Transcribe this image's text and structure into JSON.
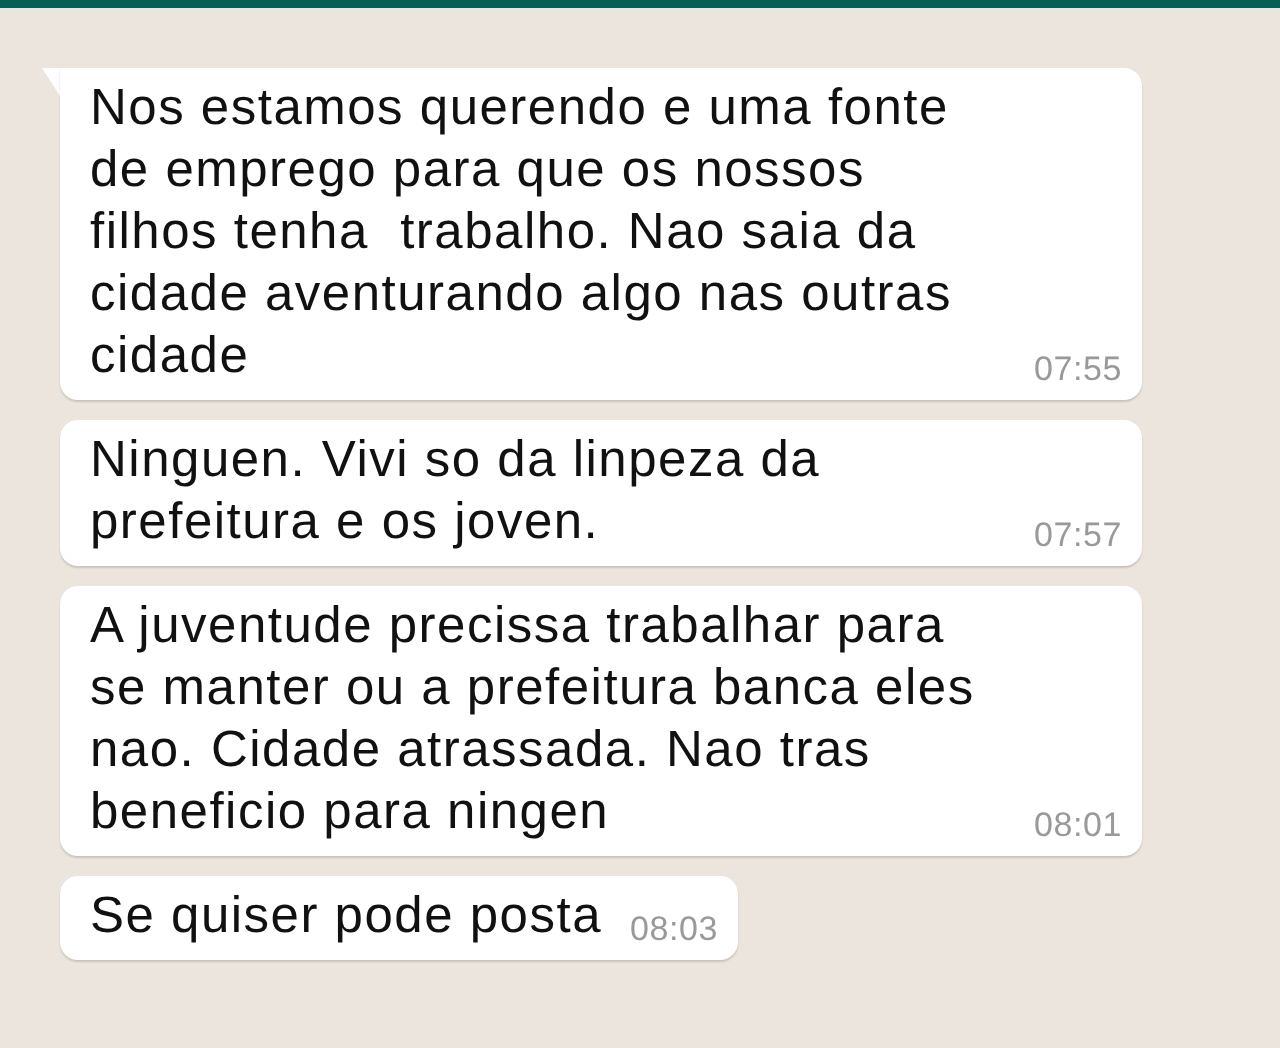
{
  "messages": [
    {
      "text": "Nos estamos querendo e uma fonte de emprego para que os nossos filhos tenha  trabalho. Nao saia da cidade aventurando algo nas outras cidade",
      "time": "07:55",
      "tail": true
    },
    {
      "text": "Ninguen. Vivi so da linpeza da prefeitura e os joven.",
      "time": "07:57",
      "tail": false
    },
    {
      "text": "A juventude precissa trabalhar para se manter ou a prefeitura banca eles nao. Cidade atrassada. Nao tras beneficio para ningen",
      "time": "08:01",
      "tail": false
    },
    {
      "text": "Se quiser pode posta",
      "time": "08:03",
      "tail": false
    }
  ]
}
